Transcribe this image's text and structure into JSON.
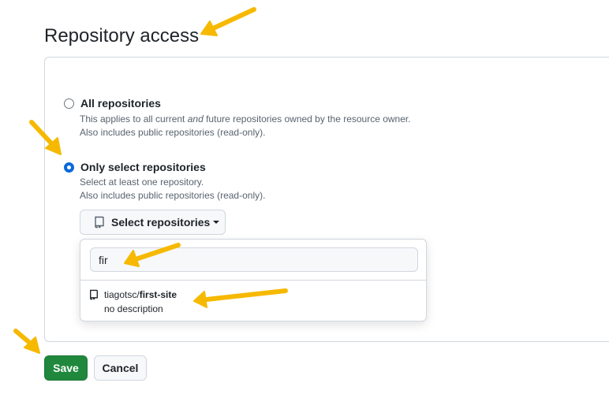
{
  "page": {
    "title": "Repository access"
  },
  "options": {
    "all": {
      "label": "All repositories",
      "desc_prefix": "This applies to all current ",
      "desc_emphasis": "and",
      "desc_suffix": " future repositories owned by the resource owner.",
      "desc_line2": "Also includes public repositories (read-only).",
      "selected": false
    },
    "select": {
      "label": "Only select repositories",
      "desc_line1": "Select at least one repository.",
      "desc_line2": "Also includes public repositories (read-only).",
      "selected": true
    }
  },
  "repo_picker": {
    "button_label": "Select repositories",
    "search_value": "fir",
    "results": [
      {
        "owner": "tiagotsc/",
        "name": "first-site",
        "description": "no description"
      }
    ]
  },
  "actions": {
    "save_label": "Save",
    "cancel_label": "Cancel"
  },
  "colors": {
    "accent": "#0969da",
    "primary_button": "#1f883d",
    "annotation_arrow": "#f6b900"
  },
  "icons": [
    "repo-icon",
    "caret-down-icon",
    "annotation-arrow"
  ]
}
